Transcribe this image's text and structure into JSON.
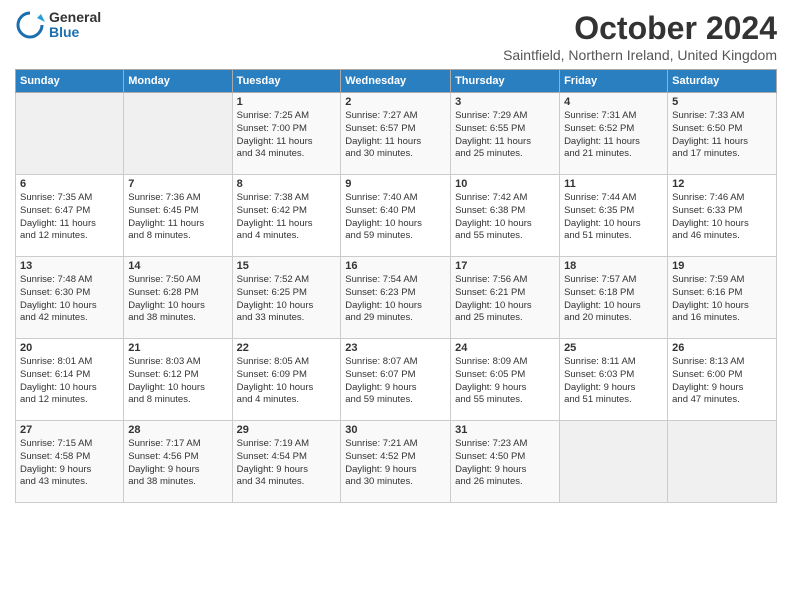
{
  "logo": {
    "general": "General",
    "blue": "Blue"
  },
  "title": "October 2024",
  "subtitle": "Saintfield, Northern Ireland, United Kingdom",
  "days_of_week": [
    "Sunday",
    "Monday",
    "Tuesday",
    "Wednesday",
    "Thursday",
    "Friday",
    "Saturday"
  ],
  "weeks": [
    [
      {
        "day": "",
        "info": ""
      },
      {
        "day": "",
        "info": ""
      },
      {
        "day": "1",
        "info": "Sunrise: 7:25 AM\nSunset: 7:00 PM\nDaylight: 11 hours\nand 34 minutes."
      },
      {
        "day": "2",
        "info": "Sunrise: 7:27 AM\nSunset: 6:57 PM\nDaylight: 11 hours\nand 30 minutes."
      },
      {
        "day": "3",
        "info": "Sunrise: 7:29 AM\nSunset: 6:55 PM\nDaylight: 11 hours\nand 25 minutes."
      },
      {
        "day": "4",
        "info": "Sunrise: 7:31 AM\nSunset: 6:52 PM\nDaylight: 11 hours\nand 21 minutes."
      },
      {
        "day": "5",
        "info": "Sunrise: 7:33 AM\nSunset: 6:50 PM\nDaylight: 11 hours\nand 17 minutes."
      }
    ],
    [
      {
        "day": "6",
        "info": "Sunrise: 7:35 AM\nSunset: 6:47 PM\nDaylight: 11 hours\nand 12 minutes."
      },
      {
        "day": "7",
        "info": "Sunrise: 7:36 AM\nSunset: 6:45 PM\nDaylight: 11 hours\nand 8 minutes."
      },
      {
        "day": "8",
        "info": "Sunrise: 7:38 AM\nSunset: 6:42 PM\nDaylight: 11 hours\nand 4 minutes."
      },
      {
        "day": "9",
        "info": "Sunrise: 7:40 AM\nSunset: 6:40 PM\nDaylight: 10 hours\nand 59 minutes."
      },
      {
        "day": "10",
        "info": "Sunrise: 7:42 AM\nSunset: 6:38 PM\nDaylight: 10 hours\nand 55 minutes."
      },
      {
        "day": "11",
        "info": "Sunrise: 7:44 AM\nSunset: 6:35 PM\nDaylight: 10 hours\nand 51 minutes."
      },
      {
        "day": "12",
        "info": "Sunrise: 7:46 AM\nSunset: 6:33 PM\nDaylight: 10 hours\nand 46 minutes."
      }
    ],
    [
      {
        "day": "13",
        "info": "Sunrise: 7:48 AM\nSunset: 6:30 PM\nDaylight: 10 hours\nand 42 minutes."
      },
      {
        "day": "14",
        "info": "Sunrise: 7:50 AM\nSunset: 6:28 PM\nDaylight: 10 hours\nand 38 minutes."
      },
      {
        "day": "15",
        "info": "Sunrise: 7:52 AM\nSunset: 6:25 PM\nDaylight: 10 hours\nand 33 minutes."
      },
      {
        "day": "16",
        "info": "Sunrise: 7:54 AM\nSunset: 6:23 PM\nDaylight: 10 hours\nand 29 minutes."
      },
      {
        "day": "17",
        "info": "Sunrise: 7:56 AM\nSunset: 6:21 PM\nDaylight: 10 hours\nand 25 minutes."
      },
      {
        "day": "18",
        "info": "Sunrise: 7:57 AM\nSunset: 6:18 PM\nDaylight: 10 hours\nand 20 minutes."
      },
      {
        "day": "19",
        "info": "Sunrise: 7:59 AM\nSunset: 6:16 PM\nDaylight: 10 hours\nand 16 minutes."
      }
    ],
    [
      {
        "day": "20",
        "info": "Sunrise: 8:01 AM\nSunset: 6:14 PM\nDaylight: 10 hours\nand 12 minutes."
      },
      {
        "day": "21",
        "info": "Sunrise: 8:03 AM\nSunset: 6:12 PM\nDaylight: 10 hours\nand 8 minutes."
      },
      {
        "day": "22",
        "info": "Sunrise: 8:05 AM\nSunset: 6:09 PM\nDaylight: 10 hours\nand 4 minutes."
      },
      {
        "day": "23",
        "info": "Sunrise: 8:07 AM\nSunset: 6:07 PM\nDaylight: 9 hours\nand 59 minutes."
      },
      {
        "day": "24",
        "info": "Sunrise: 8:09 AM\nSunset: 6:05 PM\nDaylight: 9 hours\nand 55 minutes."
      },
      {
        "day": "25",
        "info": "Sunrise: 8:11 AM\nSunset: 6:03 PM\nDaylight: 9 hours\nand 51 minutes."
      },
      {
        "day": "26",
        "info": "Sunrise: 8:13 AM\nSunset: 6:00 PM\nDaylight: 9 hours\nand 47 minutes."
      }
    ],
    [
      {
        "day": "27",
        "info": "Sunrise: 7:15 AM\nSunset: 4:58 PM\nDaylight: 9 hours\nand 43 minutes."
      },
      {
        "day": "28",
        "info": "Sunrise: 7:17 AM\nSunset: 4:56 PM\nDaylight: 9 hours\nand 38 minutes."
      },
      {
        "day": "29",
        "info": "Sunrise: 7:19 AM\nSunset: 4:54 PM\nDaylight: 9 hours\nand 34 minutes."
      },
      {
        "day": "30",
        "info": "Sunrise: 7:21 AM\nSunset: 4:52 PM\nDaylight: 9 hours\nand 30 minutes."
      },
      {
        "day": "31",
        "info": "Sunrise: 7:23 AM\nSunset: 4:50 PM\nDaylight: 9 hours\nand 26 minutes."
      },
      {
        "day": "",
        "info": ""
      },
      {
        "day": "",
        "info": ""
      }
    ]
  ]
}
